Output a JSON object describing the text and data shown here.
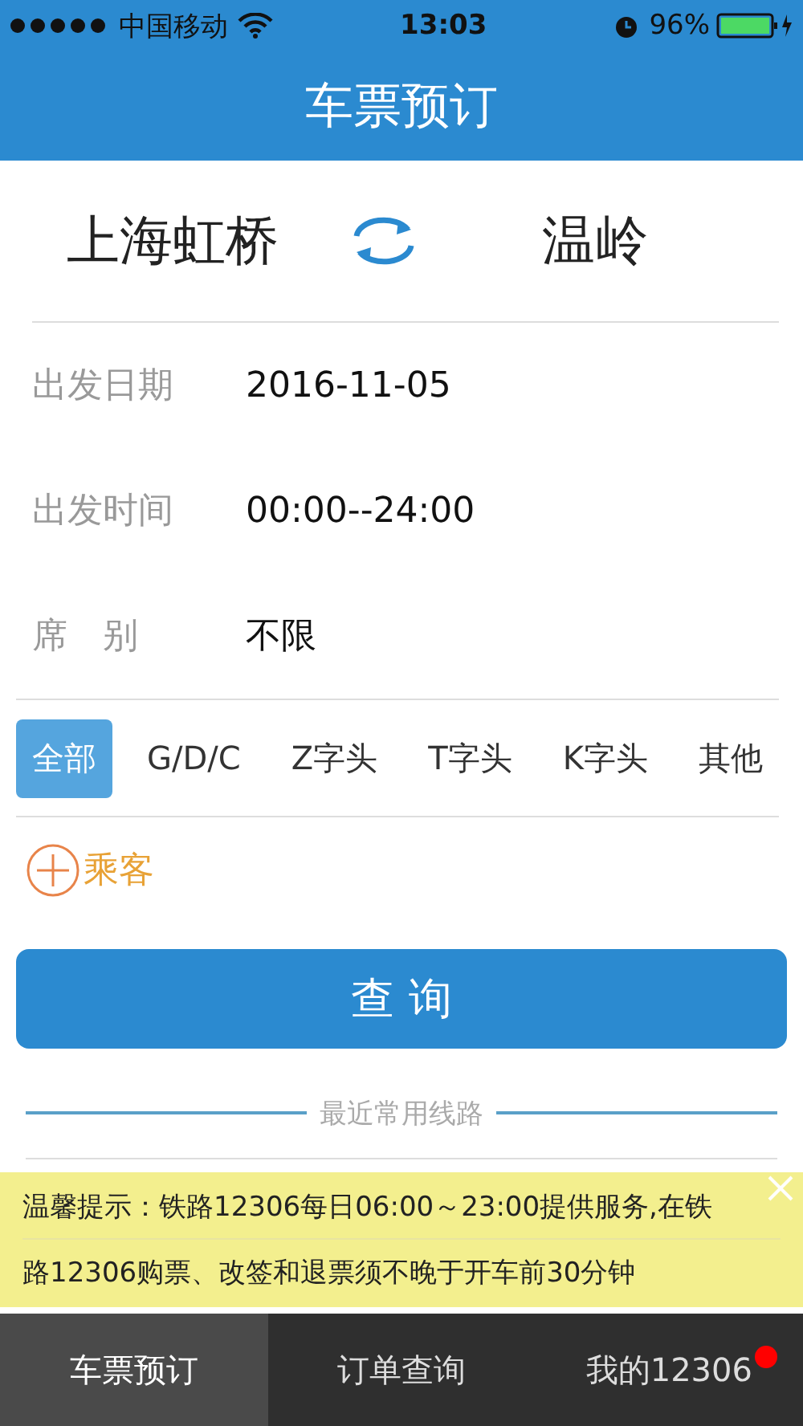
{
  "status_bar": {
    "carrier": "中国移动",
    "time": "13:03",
    "battery": "96%"
  },
  "header": {
    "title": "车票预订"
  },
  "route": {
    "from": "上海虹桥",
    "to": "温岭"
  },
  "fields": [
    {
      "label": "出发日期",
      "value": "2016-11-05"
    },
    {
      "label": "出发时间",
      "value": "00:00--24:00"
    },
    {
      "label": "席　别",
      "value": "不限"
    }
  ],
  "train_types": [
    {
      "label": "全部",
      "selected": true
    },
    {
      "label": "G/D/C",
      "selected": false
    },
    {
      "label": "Z字头",
      "selected": false
    },
    {
      "label": "T字头",
      "selected": false
    },
    {
      "label": "K字头",
      "selected": false
    },
    {
      "label": "其他",
      "selected": false
    }
  ],
  "add_passenger": "乘客",
  "query_button": "查 询",
  "recent_routes_title": "最近常用线路",
  "notice": {
    "lines": [
      "温馨提示：铁路12306每日06:00～23:00提供服务,在铁",
      "路12306购票、改签和退票须不晚于开车前30分钟"
    ]
  },
  "tab_bar": [
    {
      "label": "车票预订",
      "selected": true,
      "badge": false
    },
    {
      "label": "订单查询",
      "selected": false,
      "badge": false
    },
    {
      "label": "我的12306",
      "selected": false,
      "badge": true
    }
  ]
}
